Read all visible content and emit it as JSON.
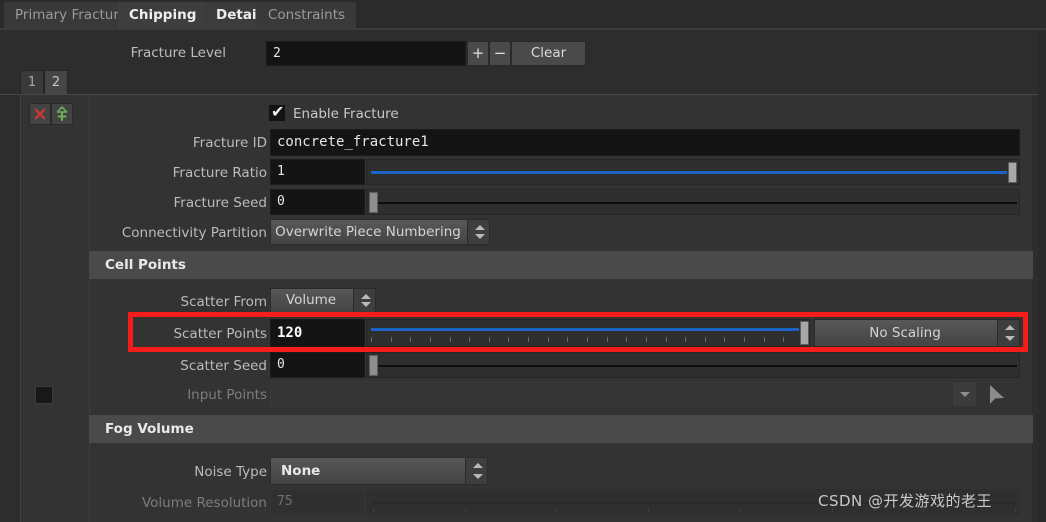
{
  "tabs": [
    {
      "label": "Primary Fracture",
      "state": "dim"
    },
    {
      "label": "Chipping",
      "state": "active"
    },
    {
      "label": "Detail",
      "state": "bold"
    },
    {
      "label": "Constraints",
      "state": "dim"
    }
  ],
  "fracture_level": {
    "label": "Fracture Level",
    "value": "2",
    "plus_label": "+",
    "minus_label": "−",
    "clear_label": "Clear"
  },
  "level_tabs": [
    {
      "label": "1"
    },
    {
      "label": "2"
    }
  ],
  "row_buttons": {
    "delete_glyph": "✖",
    "add_glyph": "⇧"
  },
  "enable_fracture": {
    "label": "Enable Fracture",
    "checked": true,
    "check_glyph": "✔"
  },
  "fields": {
    "fracture_id": {
      "label": "Fracture ID",
      "value": "concrete_fracture1"
    },
    "fracture_ratio": {
      "label": "Fracture Ratio",
      "value": "1",
      "slider_percent": 100
    },
    "fracture_seed": {
      "label": "Fracture Seed",
      "value": "0",
      "slider_percent": 0
    },
    "connectivity_partition": {
      "label": "Connectivity Partition",
      "value": "Overwrite Piece Numbering"
    }
  },
  "sections": {
    "cell_points": "Cell Points",
    "fog_volume": "Fog Volume"
  },
  "cell_points": {
    "scatter_from": {
      "label": "Scatter From",
      "value": "Volume"
    },
    "scatter_points": {
      "label": "Scatter Points",
      "value": "120",
      "slider_percent": 100,
      "scaling": "No Scaling"
    },
    "scatter_seed": {
      "label": "Scatter Seed",
      "value": "0",
      "slider_percent": 0
    },
    "input_points": {
      "label": "Input Points",
      "value": "",
      "enabled": false
    }
  },
  "fog_volume": {
    "noise_type": {
      "label": "Noise Type",
      "value": "None"
    },
    "volume_resolution": {
      "label": "Volume Resolution",
      "value": "75",
      "enabled": false
    }
  },
  "watermark": "CSDN @开发游戏的老王",
  "colors": {
    "accent_blue": "#1c64c4",
    "highlight_red": "#f71c1c",
    "panel_bg": "#333333",
    "section_bg": "#4a4a4a"
  }
}
